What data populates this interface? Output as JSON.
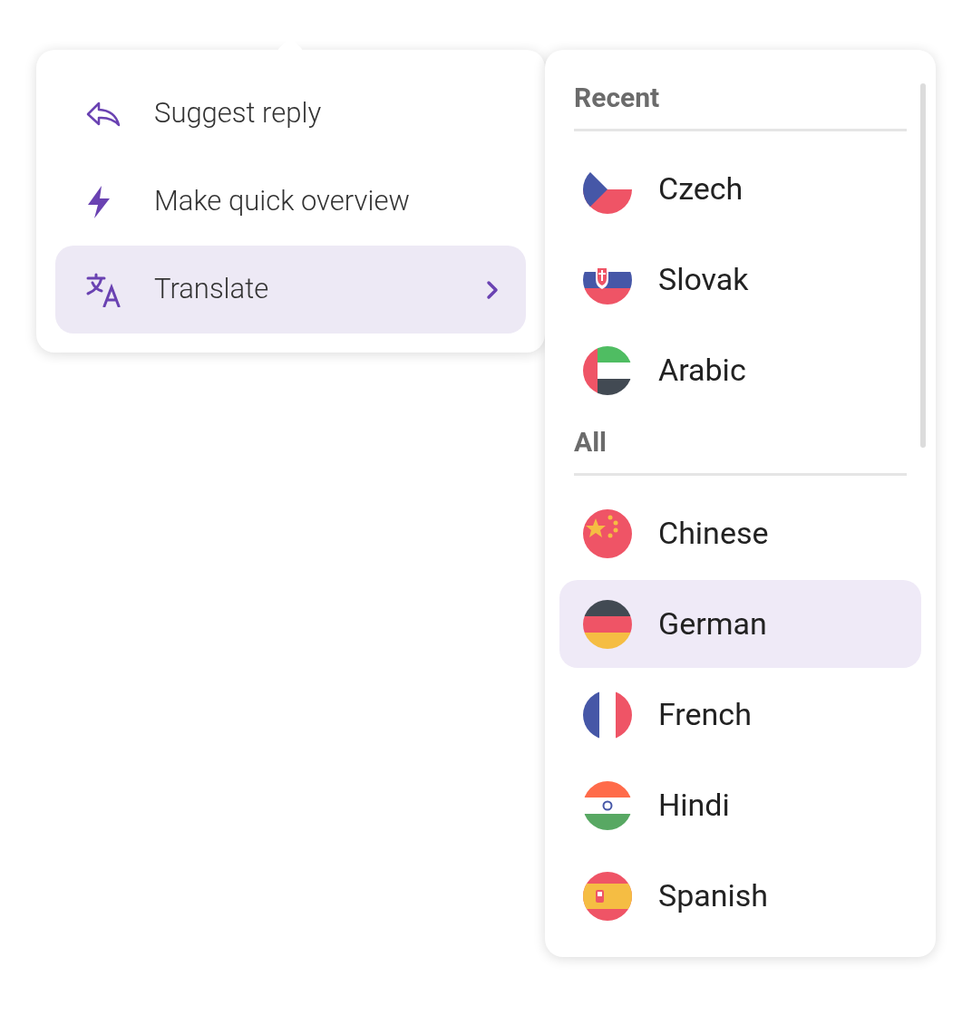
{
  "menu": {
    "items": [
      {
        "label": "Suggest reply",
        "selected": false,
        "submenu": false
      },
      {
        "label": "Make quick overview",
        "selected": false,
        "submenu": false
      },
      {
        "label": "Translate",
        "selected": true,
        "submenu": true
      }
    ]
  },
  "languages": {
    "sections": [
      {
        "title": "Recent",
        "items": [
          {
            "label": "Czech",
            "selected": false
          },
          {
            "label": "Slovak",
            "selected": false
          },
          {
            "label": "Arabic",
            "selected": false
          }
        ]
      },
      {
        "title": "All",
        "items": [
          {
            "label": "Chinese",
            "selected": false
          },
          {
            "label": "German",
            "selected": true
          },
          {
            "label": "French",
            "selected": false
          },
          {
            "label": "Hindi",
            "selected": false
          },
          {
            "label": "Spanish",
            "selected": false
          }
        ]
      }
    ]
  }
}
